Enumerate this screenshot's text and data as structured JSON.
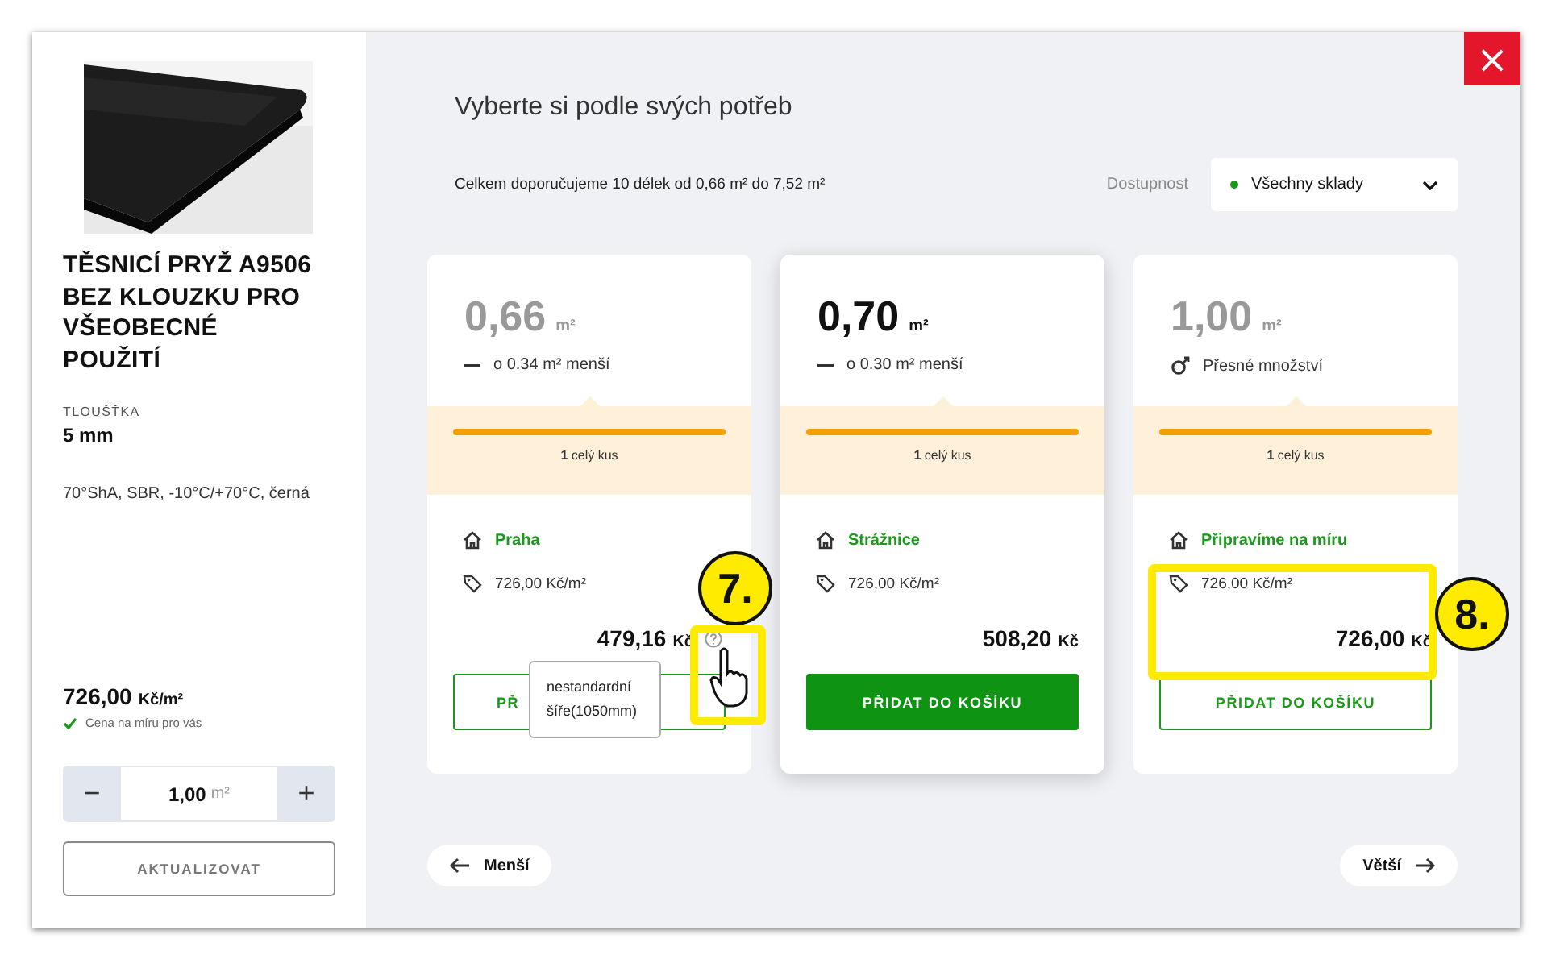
{
  "product": {
    "title": "TĚSNICÍ PRYŽ A9506 BEZ KLOUZKU PRO VŠEOBECNÉ POUŽITÍ",
    "param_label": "TLOUŠŤKA",
    "param_value": "5 mm",
    "description": "70°ShA, SBR, -10°C/+70°C, černá",
    "price": "726,00",
    "price_unit": "Kč/m²",
    "price_note": "Cena na míru pro vás",
    "quantity": "1,00",
    "quantity_unit": "m²",
    "minus": "−",
    "plus": "+",
    "update_button": "AKTUALIZOVAT"
  },
  "close": "×",
  "heading": "Vyberte si podle svých potřeb",
  "summary": "Celkem doporučujeme 10 délek od 0,66 m² do 7,52 m²",
  "availability": {
    "label": "Dostupnost",
    "value": "Všechny sklady",
    "color": "#1a9a1a"
  },
  "cards": [
    {
      "selected": false,
      "value": "0,66",
      "unit": "m²",
      "kind": "smaller",
      "note": "o 0.34 m² menší",
      "level": 1,
      "pieces_count": "1",
      "pieces_label": "celý kus",
      "location": "Praha",
      "unit_price": "726,00 Kč/m²",
      "total": "479,16",
      "currency": "Kč",
      "button": "PŘ",
      "help": true
    },
    {
      "selected": true,
      "value": "0,70",
      "unit": "m²",
      "kind": "smaller",
      "note": "o 0.30 m² menší",
      "level": 1,
      "pieces_count": "1",
      "pieces_label": "celý kus",
      "location": "Strážnice",
      "unit_price": "726,00 Kč/m²",
      "total": "508,20",
      "currency": "Kč",
      "button": "PŘIDAT DO KOŠÍKU",
      "help": false
    },
    {
      "selected": false,
      "value": "1,00",
      "unit": "m²",
      "kind": "exact",
      "note": "Přesné množství",
      "level": 1,
      "pieces_count": "1",
      "pieces_label": "celý kus",
      "location": "Připravíme na míru",
      "unit_price": "726,00 Kč/m²",
      "total": "726,00",
      "currency": "Kč",
      "button": "PŘIDAT DO KOŠÍKU",
      "help": false
    }
  ],
  "tooltip": "nestandardní šíře(1050mm)",
  "nav": {
    "prev": "Menší",
    "next": "Větší"
  },
  "annotations": [
    {
      "label": "7."
    },
    {
      "label": "8."
    }
  ]
}
